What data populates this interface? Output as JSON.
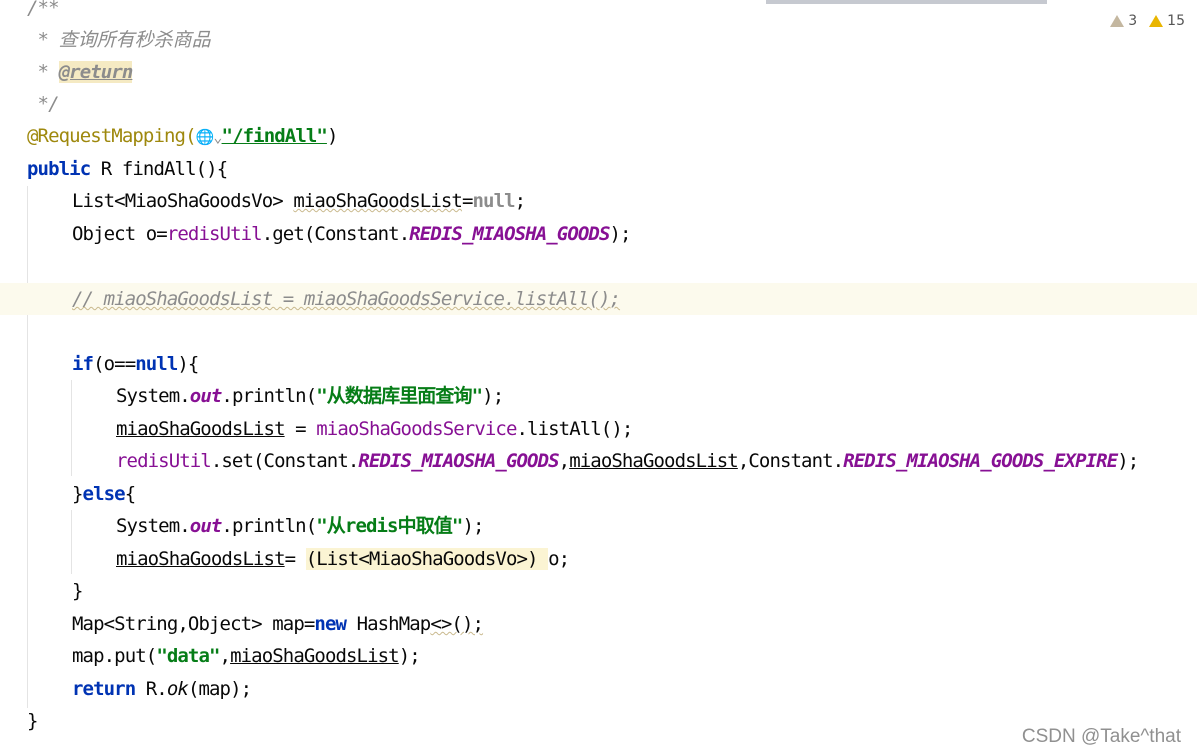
{
  "editor": {
    "inspections": {
      "weak_warnings": "3",
      "warnings": "15"
    },
    "lines": {
      "l0": "/**",
      "l1_star": " * ",
      "l1_text": "查询所有秒杀商品",
      "l2_star": " * ",
      "l2_tag": "@return",
      "l3": " */",
      "l4_ann": "@RequestMapping(",
      "l4_icon": "🌐⌄",
      "l4_str": "\"/findAll\"",
      "l4_close": ")",
      "l5_kw": "public",
      "l5_rest": " R findAll(){",
      "l6_type": "List<MiaoShaGoodsVo> ",
      "l6_var": "miaoShaGoodsList",
      "l6_eq": "=",
      "l6_null": "null",
      "l6_semi": ";",
      "l7_a": "Object o=",
      "l7_fld": "redisUtil",
      "l7_b": ".get(Constant.",
      "l7_const": "REDIS_MIAOSHA_GOODS",
      "l7_c": ");",
      "l9_comment": "// miaoShaGoodsList = miaoShaGoodsService.listAll();",
      "l11_kw": "if",
      "l11_a": "(o==",
      "l11_null": "null",
      "l11_b": "){",
      "l12_a": "System.",
      "l12_out": "out",
      "l12_b": ".println(",
      "l12_str": "\"从数据库里面查询\"",
      "l12_c": ");",
      "l13_var": "miaoShaGoodsList",
      "l13_a": " = ",
      "l13_fld": "miaoShaGoodsService",
      "l13_b": ".listAll();",
      "l14_fld": "redisUtil",
      "l14_a": ".set(Constant.",
      "l14_const1": "REDIS_MIAOSHA_GOODS",
      "l14_b": ",",
      "l14_var": "miaoShaGoodsList",
      "l14_c": ",Constant.",
      "l14_const2": "REDIS_MIAOSHA_GOODS_EXPIRE",
      "l14_d": ");",
      "l15_a": "}",
      "l15_kw": "else",
      "l15_b": "{",
      "l16_a": "System.",
      "l16_out": "out",
      "l16_b": ".println(",
      "l16_str": "\"从redis中取值\"",
      "l16_c": ");",
      "l17_var": "miaoShaGoodsList",
      "l17_a": "= ",
      "l17_cast": "(List<MiaoShaGoodsVo>) ",
      "l17_b": "o;",
      "l18": "}",
      "l19_a": "Map<String,Object> map=",
      "l19_kw": "new",
      "l19_b": " HashMap",
      "l19_c": "<>();",
      "l20_a": "map.put(",
      "l20_str": "\"data\"",
      "l20_b": ",",
      "l20_var": "miaoShaGoodsList",
      "l20_c": ");",
      "l21_kw": "return",
      "l21_a": " R.",
      "l21_ok": "ok",
      "l21_b": "(map);",
      "l22": "}"
    }
  },
  "watermark": "CSDN @Take^that"
}
